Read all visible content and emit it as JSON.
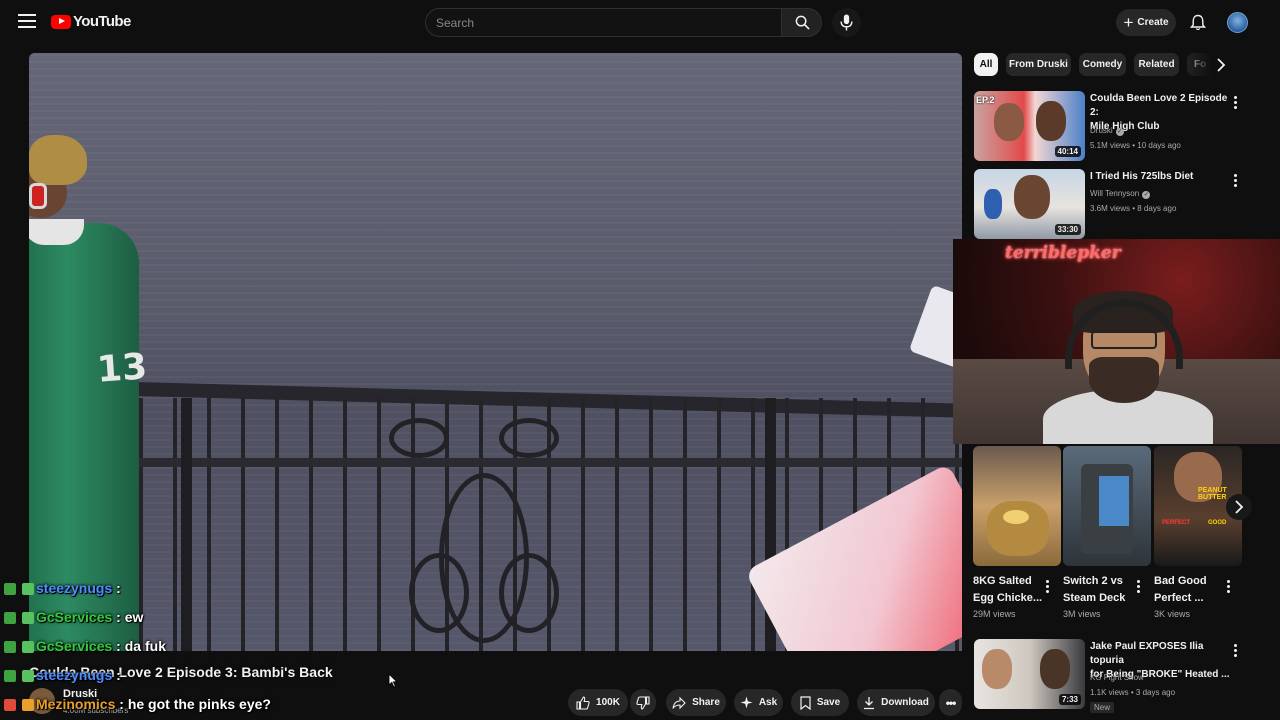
{
  "header": {
    "logo_text": "YouTube",
    "search_placeholder": "Search",
    "create_label": "Create"
  },
  "chat": [
    {
      "user": "steezynugs",
      "sep": " : ",
      "message": "",
      "color": "#4f8cff"
    },
    {
      "user": "GcServices",
      "sep": " : ",
      "message": "ew",
      "color": "#37c93f"
    },
    {
      "user": "GcServices",
      "sep": " : ",
      "message": "da fuk",
      "color": "#37c93f"
    },
    {
      "user": "steezynugs",
      "sep": " : ",
      "message": "",
      "color": "#4f8cff"
    },
    {
      "user": "Mezinomics",
      "sep": " : ",
      "message": "he got the pinks eye?",
      "color": "#e8a02b"
    }
  ],
  "video": {
    "title": "Coulda Been Love 2 Episode 3: Bambi's Back",
    "channel": "Druski",
    "subscribers": "4.00M subscribers"
  },
  "actions": {
    "like_count": "100K",
    "share_label": "Share",
    "ask_label": "Ask",
    "save_label": "Save",
    "download_label": "Download"
  },
  "chips": [
    "All",
    "From Druski",
    "Comedy",
    "Related",
    "Fo"
  ],
  "recommendations": [
    {
      "title_line1": "Coulda Been Love 2 Episode 2:",
      "title_line2": "Mile High Club",
      "channel": "Druski",
      "stats": "5.1M views • 10 days ago",
      "duration": "40:14",
      "thumb_label": "EP.2"
    },
    {
      "title_line1": "I Tried His 725lbs Diet",
      "title_line2": "",
      "channel": "Will Tennyson",
      "stats": "3.6M views • 8 days ago",
      "duration": "33:30"
    },
    {
      "title_line1": "Jake Paul EXPOSES Ilia topuria",
      "title_line2": "for Being \"BROKE\" Heated ...",
      "channel": "KG Fight Show",
      "stats": "1.1K views • 3 days ago",
      "duration": "7:33",
      "badge": "New"
    }
  ],
  "shorts": [
    {
      "title_line1": "8KG Salted",
      "title_line2": "Egg Chicke...",
      "views": "29M views"
    },
    {
      "title_line1": "Switch 2 vs",
      "title_line2": "Steam Deck",
      "views": "3M views"
    },
    {
      "title_line1": "Bad Good",
      "title_line2": "Perfect ...",
      "views": "3K views",
      "thumb_text1": "PEANUT BUTTER",
      "thumb_text2": "PERFECT",
      "thumb_text3": "GOOD"
    }
  ],
  "webcam": {
    "sign_text": "terriblepker"
  },
  "colors": {
    "background": "#0f0f0f",
    "brand_red": "#ff0000",
    "chip_bg": "#272727"
  }
}
